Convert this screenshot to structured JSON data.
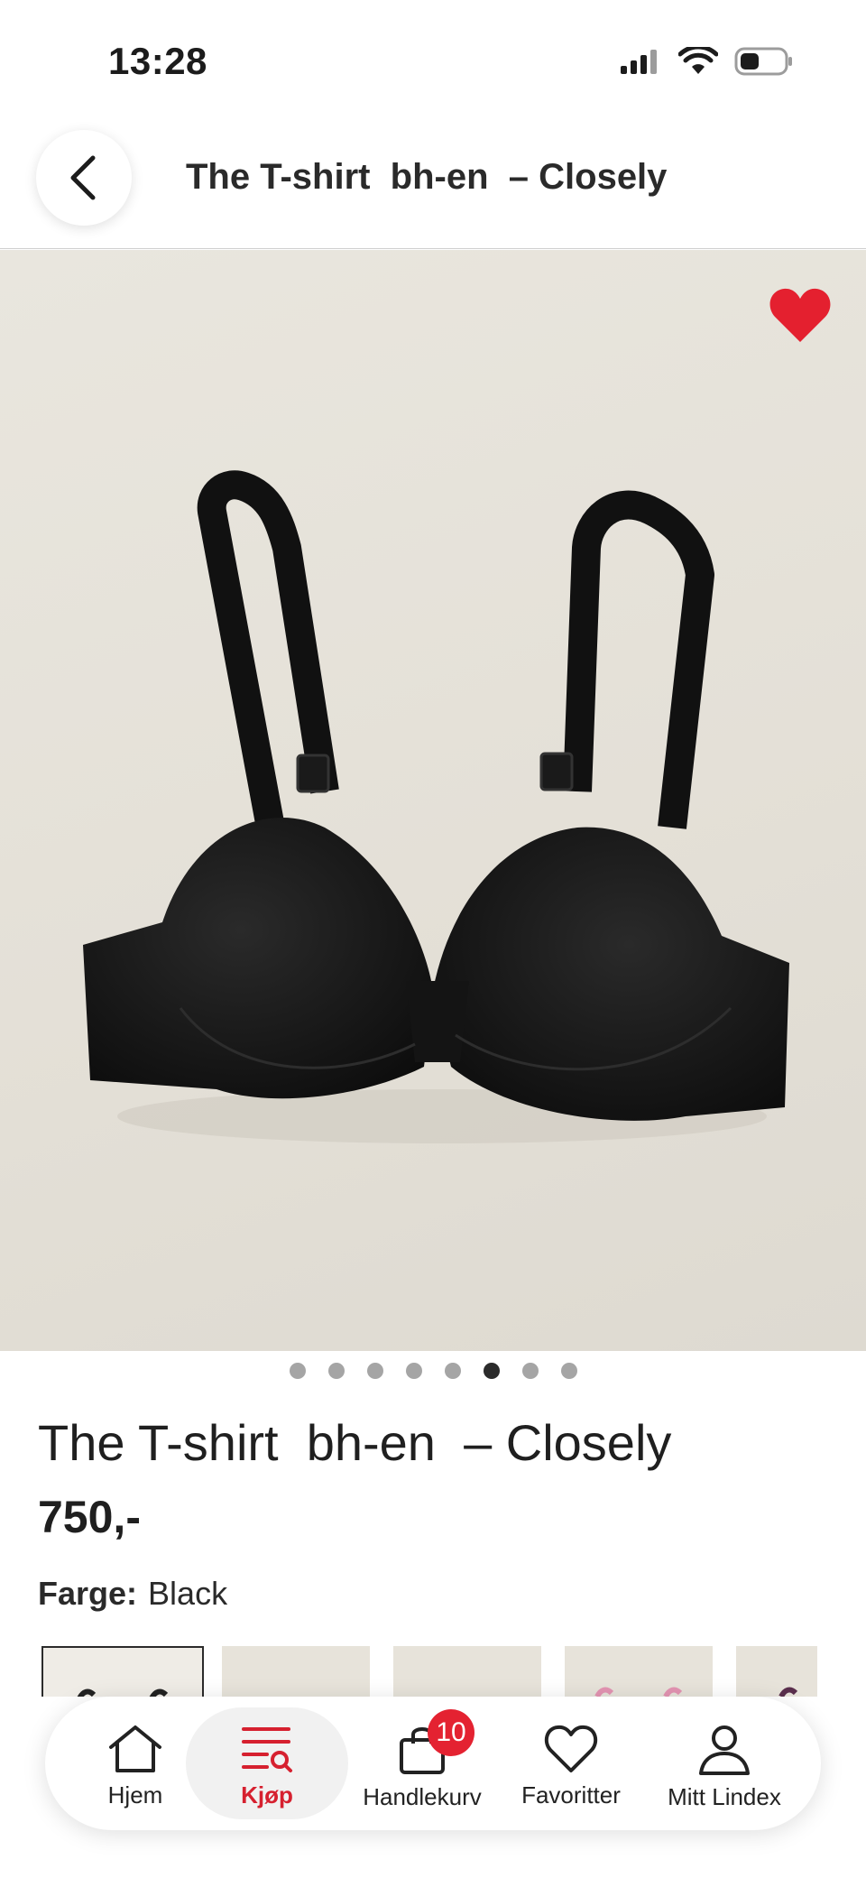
{
  "status_bar": {
    "time": "13:28",
    "icons": [
      "signal-icon",
      "wifi-icon",
      "battery-icon"
    ]
  },
  "header": {
    "title": "The T-shirt  bh-en  – Closely",
    "back_icon": "chevron-left-icon"
  },
  "product": {
    "favorite_icon": "heart-icon",
    "favorite_color": "#e4202f",
    "image_count": 8,
    "active_image_index": 5,
    "title": "The T-shirt  bh-en  – Closely",
    "price": "750,-",
    "color_label": "Farge:",
    "color_value": "Black"
  },
  "bottom_nav": {
    "items": [
      {
        "label": "Hjem",
        "icon": "home-icon"
      },
      {
        "label": "Kjøp",
        "icon": "shop-search-icon",
        "active": true
      },
      {
        "label": "Handlekurv",
        "icon": "shopping-bag-icon",
        "badge": "10"
      },
      {
        "label": "Favoritter",
        "icon": "heart-outline-icon"
      },
      {
        "label": "Mitt Lindex",
        "icon": "user-icon"
      }
    ],
    "accent": "#d6202f"
  }
}
